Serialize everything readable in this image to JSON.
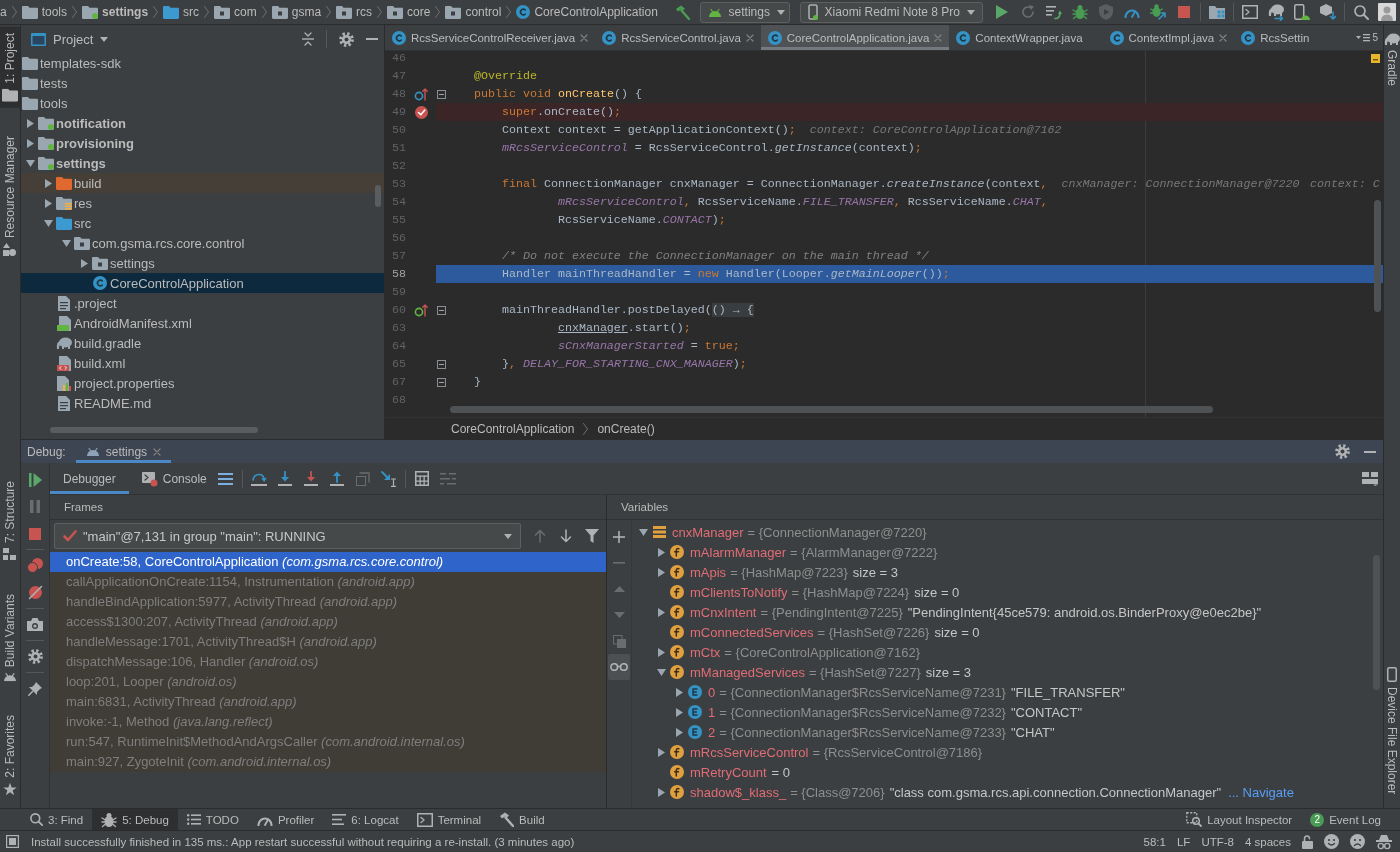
{
  "navbar": {
    "breadcrumbs": [
      {
        "label": "a"
      },
      {
        "label": "tools",
        "kind": "folder"
      },
      {
        "label": "settings",
        "kind": "module"
      },
      {
        "label": "src",
        "kind": "source"
      },
      {
        "label": "com",
        "kind": "package"
      },
      {
        "label": "gsma",
        "kind": "package"
      },
      {
        "label": "rcs",
        "kind": "package"
      },
      {
        "label": "core",
        "kind": "package"
      },
      {
        "label": "control",
        "kind": "package"
      },
      {
        "label": "CoreControlApplication",
        "kind": "class"
      }
    ],
    "toolbar": [
      [
        {
          "kind": "make",
          "disabled": false
        },
        {
          "kind": "config",
          "label": "settings"
        },
        {
          "kind": "device",
          "label": "Xiaomi Redmi Note 8 Pro"
        },
        {
          "kind": "run",
          "disabled": false
        },
        {
          "kind": "apply-restart",
          "disabled": true
        },
        {
          "kind": "apply-code",
          "disabled": false
        },
        {
          "kind": "debug",
          "disabled": false
        },
        {
          "kind": "coverage",
          "disabled": true
        },
        {
          "kind": "profile",
          "disabled": false
        },
        {
          "kind": "attach",
          "disabled": false
        },
        {
          "kind": "stop",
          "disabled": false
        }
      ],
      [
        {
          "kind": "project-structure",
          "disabled": false
        }
      ],
      [
        {
          "kind": "terminal",
          "disabled": false
        },
        {
          "kind": "gradle-sync",
          "disabled": false
        },
        {
          "kind": "avd",
          "disabled": false
        },
        {
          "kind": "sdk",
          "disabled": false
        }
      ],
      [
        {
          "kind": "search",
          "disabled": false
        },
        {
          "kind": "avatar"
        }
      ]
    ]
  },
  "left_strip": {
    "top": [
      {
        "label": "1: Project",
        "kind": "project",
        "selected": true
      },
      {
        "label": "Resource Manager",
        "kind": "resources",
        "selected": false
      }
    ],
    "bottom": [
      {
        "label": "7: Structure",
        "kind": "structure",
        "selected": false
      },
      {
        "label": "Build Variants",
        "kind": "build-variants",
        "selected": false
      },
      {
        "label": "2: Favorites",
        "kind": "favorites",
        "selected": false
      }
    ]
  },
  "right_strip": {
    "top": [
      {
        "label": "Gradle",
        "kind": "gradle",
        "selected": false
      }
    ],
    "bottom": [
      {
        "label": "Device File Explorer",
        "kind": "device-explorer",
        "selected": false
      }
    ]
  },
  "project": {
    "title": "Project",
    "tree": [
      {
        "label": "templates-sdk",
        "kind": "folder",
        "selected": false
      },
      {
        "label": "tests",
        "kind": "folder",
        "selected": false
      },
      {
        "label": "tools",
        "kind": "folder",
        "selected": false,
        "children": [
          {
            "label": "notification",
            "kind": "module",
            "expanded": false,
            "selected": false
          },
          {
            "label": "provisioning",
            "kind": "module",
            "expanded": false,
            "selected": false
          },
          {
            "label": "settings",
            "kind": "module",
            "expanded": true,
            "selected": false,
            "children": [
              {
                "label": "build",
                "kind": "excluded",
                "expanded": false,
                "selected": false
              },
              {
                "label": "res",
                "kind": "resources",
                "expanded": false,
                "selected": false
              },
              {
                "label": "src",
                "kind": "source",
                "expanded": true,
                "selected": false,
                "children": [
                  {
                    "label": "com.gsma.rcs.core.control",
                    "kind": "package",
                    "expanded": true,
                    "selected": false,
                    "children": [
                      {
                        "label": "settings",
                        "kind": "package",
                        "expanded": false,
                        "selected": false
                      },
                      {
                        "label": "CoreControlApplication",
                        "kind": "class",
                        "selected": true
                      }
                    ]
                  }
                ]
              },
              {
                "label": ".project",
                "kind": "file",
                "selected": false
              },
              {
                "label": "AndroidManifest.xml",
                "kind": "manifest",
                "selected": false
              },
              {
                "label": "build.gradle",
                "kind": "gradle",
                "selected": false
              },
              {
                "label": "build.xml",
                "kind": "xml",
                "selected": false
              },
              {
                "label": "project.properties",
                "kind": "properties",
                "selected": false
              },
              {
                "label": "README.md",
                "kind": "file",
                "selected": false
              }
            ]
          }
        ]
      }
    ]
  },
  "editor": {
    "tabs": [
      {
        "label": "RcsServiceControlReceiver.java",
        "selected": false,
        "closable": true
      },
      {
        "label": "RcsServiceControl.java",
        "selected": false,
        "closable": true
      },
      {
        "label": "CoreControlApplication.java",
        "selected": true,
        "closable": true
      },
      {
        "label": "ContextWrapper.java",
        "selected": false,
        "closable": false
      },
      {
        "label": "ContextImpl.java",
        "selected": false,
        "closable": true
      },
      {
        "label": "RcsSettin",
        "selected": false,
        "closable": false
      }
    ],
    "hidden_tabs": "5",
    "lines": [
      {
        "number": "46",
        "breakpoint": false,
        "current": false,
        "fold": false
      },
      {
        "number": "47",
        "breakpoint": false,
        "current": false,
        "fold": false,
        "tokens": [
          {
            "text": "    @Override",
            "kind": "annotation"
          }
        ]
      },
      {
        "number": "48",
        "breakpoint": false,
        "current": false,
        "fold": true,
        "marker": {
          "kind": "override"
        },
        "tokens": [
          {
            "text": "    public void ",
            "kind": "keyword"
          },
          {
            "text": "onCreate",
            "kind": "method"
          },
          {
            "text": "() {",
            "kind": "plain"
          }
        ]
      },
      {
        "number": "49",
        "breakpoint": true,
        "current": false,
        "fold": false,
        "tokens": [
          {
            "text": "        super",
            "kind": "keyword"
          },
          {
            "text": ".onCreate()",
            "kind": "plain"
          },
          {
            "text": ";",
            "kind": "keyword"
          }
        ]
      },
      {
        "number": "50",
        "breakpoint": false,
        "current": false,
        "fold": false,
        "tokens": [
          {
            "text": "        Context context = getApplicationContext()",
            "kind": "plain"
          },
          {
            "text": ";",
            "kind": "keyword"
          }
        ],
        "hints": [
          "context: CoreControlApplication@7162"
        ]
      },
      {
        "number": "51",
        "breakpoint": false,
        "current": false,
        "fold": false,
        "tokens": [
          {
            "text": "        mRcsServiceControl",
            "kind": "field"
          },
          {
            "text": " = RcsServiceControl.",
            "kind": "plain"
          },
          {
            "text": "getInstance",
            "kind": "call"
          },
          {
            "text": "(context)",
            "kind": "plain"
          },
          {
            "text": ";",
            "kind": "keyword"
          }
        ]
      },
      {
        "number": "52",
        "breakpoint": false,
        "current": false,
        "fold": false
      },
      {
        "number": "53",
        "breakpoint": false,
        "current": false,
        "fold": false,
        "tokens": [
          {
            "text": "        final ",
            "kind": "keyword"
          },
          {
            "text": "ConnectionManager cnxManager = ConnectionManager.",
            "kind": "plain"
          },
          {
            "text": "createInstance",
            "kind": "call"
          },
          {
            "text": "(context",
            "kind": "plain"
          },
          {
            "text": ",",
            "kind": "keyword"
          }
        ],
        "hints": [
          "cnxManager: ConnectionManager@7220",
          "context: C"
        ]
      },
      {
        "number": "54",
        "breakpoint": false,
        "current": false,
        "fold": false,
        "tokens": [
          {
            "text": "                mRcsServiceControl",
            "kind": "field"
          },
          {
            "text": ", ",
            "kind": "keyword"
          },
          {
            "text": "RcsServiceName.",
            "kind": "plain"
          },
          {
            "text": "FILE_TRANSFER",
            "kind": "static"
          },
          {
            "text": ", ",
            "kind": "keyword"
          },
          {
            "text": "RcsServiceName.",
            "kind": "plain"
          },
          {
            "text": "CHAT",
            "kind": "static"
          },
          {
            "text": ",",
            "kind": "keyword"
          }
        ]
      },
      {
        "number": "55",
        "breakpoint": false,
        "current": false,
        "fold": false,
        "tokens": [
          {
            "text": "                RcsServiceName.",
            "kind": "plain"
          },
          {
            "text": "CONTACT",
            "kind": "static"
          },
          {
            "text": ")",
            "kind": "plain"
          },
          {
            "text": ";",
            "kind": "keyword"
          }
        ]
      },
      {
        "number": "56",
        "breakpoint": false,
        "current": false,
        "fold": false
      },
      {
        "number": "57",
        "breakpoint": false,
        "current": false,
        "fold": false,
        "tokens": [
          {
            "text": "        /* Do not execute the ConnectionManager on the main thread */",
            "kind": "comment"
          }
        ]
      },
      {
        "number": "58",
        "breakpoint": false,
        "current": true,
        "fold": false,
        "tokens": [
          {
            "text": "        Handler mainThreadHandler = ",
            "kind": "plain"
          },
          {
            "text": "new",
            "kind": "keyword"
          },
          {
            "text": " Handler(Looper.",
            "kind": "plain"
          },
          {
            "text": "getMainLooper",
            "kind": "call"
          },
          {
            "text": "())",
            "kind": "plain"
          },
          {
            "text": ";",
            "kind": "keyword"
          }
        ]
      },
      {
        "number": "59",
        "breakpoint": false,
        "current": false,
        "fold": false
      },
      {
        "number": "60",
        "breakpoint": false,
        "current": false,
        "fold": true,
        "marker": {
          "kind": "implements"
        },
        "tokens": [
          {
            "text": "        mainThreadHandler.postDelayed(",
            "kind": "plain"
          },
          {
            "text": "() → {",
            "kind": "folded"
          }
        ]
      },
      {
        "number": "63",
        "breakpoint": false,
        "current": false,
        "fold": false,
        "tokens": [
          {
            "text": "                cnxManager",
            "kind": "captured"
          },
          {
            "text": ".start()",
            "kind": "plain"
          },
          {
            "text": ";",
            "kind": "keyword"
          }
        ]
      },
      {
        "number": "64",
        "breakpoint": false,
        "current": false,
        "fold": false,
        "tokens": [
          {
            "text": "                sCnxManagerStarted",
            "kind": "static"
          },
          {
            "text": " = ",
            "kind": "plain"
          },
          {
            "text": "true",
            "kind": "keyword"
          },
          {
            "text": ";",
            "kind": "keyword"
          }
        ]
      },
      {
        "number": "65",
        "breakpoint": false,
        "current": false,
        "fold": true,
        "tokens": [
          {
            "text": "        }",
            "kind": "plain"
          },
          {
            "text": ", ",
            "kind": "keyword"
          },
          {
            "text": "DELAY_FOR_STARTING_CNX_MANAGER",
            "kind": "static"
          },
          {
            "text": ")",
            "kind": "plain"
          },
          {
            "text": ";",
            "kind": "keyword"
          }
        ]
      },
      {
        "number": "67",
        "breakpoint": false,
        "current": false,
        "fold": true,
        "tokens": [
          {
            "text": "    }",
            "kind": "plain"
          }
        ]
      },
      {
        "number": "68",
        "breakpoint": false,
        "current": false,
        "fold": false
      }
    ],
    "breadcrumbs": [
      "CoreControlApplication",
      "onCreate()"
    ]
  },
  "debug": {
    "title": "Debug:",
    "sessions": [
      {
        "label": "settings",
        "selected": true
      }
    ],
    "tabs": [
      {
        "label": "Debugger",
        "kind": "debugger",
        "selected": true
      },
      {
        "label": "Console",
        "kind": "console",
        "selected": false
      }
    ],
    "stepping": [
      [
        {
          "kind": "threads",
          "disabled": false
        }
      ],
      [
        {
          "kind": "step-over",
          "disabled": false
        },
        {
          "kind": "step-into",
          "disabled": false
        },
        {
          "kind": "force-step-into",
          "disabled": false
        },
        {
          "kind": "step-out",
          "disabled": false
        },
        {
          "kind": "drop-frame",
          "disabled": true
        },
        {
          "kind": "run-to-cursor",
          "disabled": false
        }
      ],
      [
        {
          "kind": "evaluate",
          "disabled": false
        },
        {
          "kind": "trace",
          "disabled": true
        }
      ]
    ],
    "side_actions": [
      [
        {
          "kind": "resume",
          "disabled": false
        },
        {
          "kind": "pause",
          "disabled": true
        },
        {
          "kind": "stop",
          "disabled": false
        }
      ],
      [
        {
          "kind": "breakpoints",
          "disabled": false
        },
        {
          "kind": "mute",
          "disabled": false
        }
      ],
      [
        {
          "kind": "camera",
          "disabled": false
        }
      ],
      [
        {
          "kind": "settings",
          "disabled": false
        }
      ],
      [
        {
          "kind": "pin",
          "disabled": false
        }
      ]
    ],
    "frames": {
      "title": "Frames",
      "thread": "\"main\"@7,131 in group \"main\": RUNNING",
      "nav": [
        {
          "kind": "up",
          "disabled": true
        },
        {
          "kind": "down",
          "disabled": false
        },
        {
          "kind": "filter",
          "disabled": false
        }
      ],
      "items": [
        {
          "text": "onCreate:58, CoreControlApplication *(com.gsma.rcs.core.control)*",
          "selected": true,
          "library": false
        },
        {
          "text": "callApplicationOnCreate:1154, Instrumentation *(android.app)*",
          "selected": false,
          "library": true
        },
        {
          "text": "handleBindApplication:5977, ActivityThread *(android.app)*",
          "selected": false,
          "library": true
        },
        {
          "text": "access$1300:207, ActivityThread *(android.app)*",
          "selected": false,
          "library": true
        },
        {
          "text": "handleMessage:1701, ActivityThread$H *(android.app)*",
          "selected": false,
          "library": true
        },
        {
          "text": "dispatchMessage:106, Handler *(android.os)*",
          "selected": false,
          "library": true
        },
        {
          "text": "loop:201, Looper *(android.os)*",
          "selected": false,
          "library": true
        },
        {
          "text": "main:6831, ActivityThread *(android.app)*",
          "selected": false,
          "library": true
        },
        {
          "text": "invoke:-1, Method *(java.lang.reflect)*",
          "selected": false,
          "library": true
        },
        {
          "text": "run:547, RuntimeInit$MethodAndArgsCaller *(com.android.internal.os)*",
          "selected": false,
          "library": true
        },
        {
          "text": "main:927, ZygoteInit *(com.android.internal.os)*",
          "selected": false,
          "library": true
        }
      ]
    },
    "variables": {
      "title": "Variables",
      "watch_tools": [
        {
          "kind": "add",
          "disabled": false,
          "on": false
        },
        {
          "kind": "remove",
          "disabled": true,
          "on": false
        },
        {
          "kind": "move-up",
          "disabled": true,
          "on": false
        },
        {
          "kind": "move-down",
          "disabled": true,
          "on": false
        },
        {
          "kind": "copy",
          "disabled": true,
          "on": false
        },
        {
          "kind": "glasses",
          "disabled": false,
          "on": true
        }
      ],
      "items": [
        {
          "name": "cnxManager",
          "kind": "local",
          "expanded": true,
          "ref": "= {ConnectionManager@7220}",
          "children": [
            {
              "name": "mAlarmManager",
              "kind": "field",
              "expanded": false,
              "ref": "= {AlarmManager@7222}"
            },
            {
              "name": "mApis",
              "kind": "field",
              "expanded": false,
              "ref": "= {HashMap@7223}",
              "detail": "size = 3"
            },
            {
              "name": "mClientsToNotify",
              "kind": "field",
              "ref": "= {HashMap@7224}",
              "detail": "size = 0"
            },
            {
              "name": "mCnxIntent",
              "kind": "field",
              "expanded": false,
              "ref": "= {PendingIntent@7225}",
              "detail": "\"PendingIntent{45ce579: android.os.BinderProxy@e0ec2be}\""
            },
            {
              "name": "mConnectedServices",
              "kind": "field",
              "ref": "= {HashSet@7226}",
              "detail": "size = 0"
            },
            {
              "name": "mCtx",
              "kind": "field",
              "expanded": false,
              "ref": "= {CoreControlApplication@7162}"
            },
            {
              "name": "mManagedServices",
              "kind": "field",
              "expanded": true,
              "ref": "= {HashSet@7227}",
              "detail": "size = 3",
              "children": [
                {
                  "name": "0",
                  "kind": "enum",
                  "expanded": false,
                  "ref": "= {ConnectionManager$RcsServiceName@7231}",
                  "detail": "\"FILE_TRANSFER\""
                },
                {
                  "name": "1",
                  "kind": "enum",
                  "expanded": false,
                  "ref": "= {ConnectionManager$RcsServiceName@7232}",
                  "detail": "\"CONTACT\""
                },
                {
                  "name": "2",
                  "kind": "enum",
                  "expanded": false,
                  "ref": "= {ConnectionManager$RcsServiceName@7233}",
                  "detail": "\"CHAT\""
                }
              ]
            },
            {
              "name": "mRcsServiceControl",
              "kind": "field",
              "expanded": false,
              "ref": "= {RcsServiceControl@7186}"
            },
            {
              "name": "mRetryCount",
              "kind": "field",
              "detail": "= 0"
            },
            {
              "name": "shadow$_klass_",
              "kind": "field",
              "expanded": false,
              "ref": "= {Class@7206}",
              "detail": "\"class com.gsma.rcs.api.connection.ConnectionManager\"",
              "link": "... Navigate"
            }
          ]
        }
      ]
    }
  },
  "tool_bar": {
    "left": [
      {
        "label": "3: Find",
        "kind": "find",
        "selected": false
      },
      {
        "label": "5: Debug",
        "kind": "debug",
        "selected": true
      },
      {
        "label": "TODO",
        "kind": "todo",
        "selected": false
      },
      {
        "label": "Profiler",
        "kind": "profiler",
        "selected": false
      },
      {
        "label": "6: Logcat",
        "kind": "logcat",
        "selected": false
      },
      {
        "label": "Terminal",
        "kind": "terminal",
        "selected": false
      },
      {
        "label": "Build",
        "kind": "build",
        "selected": false
      }
    ],
    "right": [
      {
        "label": "Layout Inspector",
        "kind": "layout-inspector",
        "selected": false
      },
      {
        "label": "Event Log",
        "kind": "event-log",
        "badge": "2",
        "selected": false
      }
    ]
  },
  "status_bar": {
    "message": "Install successfully finished in 135 ms.: App restart successful without requiring a re-install. (3 minutes ago)",
    "items": [
      "58:1",
      "LF",
      "UTF-8",
      "4 spaces"
    ]
  }
}
